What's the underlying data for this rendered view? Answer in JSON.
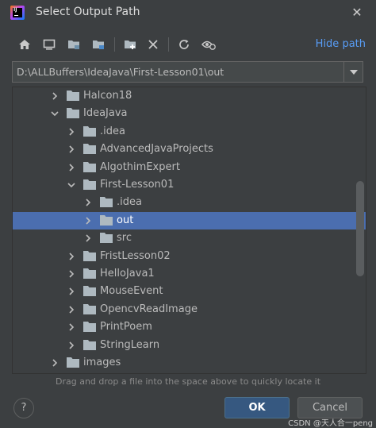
{
  "window": {
    "title": "Select Output Path"
  },
  "toolbar": {
    "icons": [
      "home-icon",
      "desktop-icon",
      "project-folder-icon",
      "module-folder-icon",
      "new-folder-icon",
      "delete-icon",
      "refresh-icon",
      "show-hidden-icon"
    ],
    "hide_path_label": "Hide path"
  },
  "path": {
    "value": "D:\\ALLBuffers\\IdeaJava\\First-Lesson01\\out"
  },
  "tree": {
    "rows": [
      {
        "label": "Halcon18",
        "depth": 0,
        "expanded": false,
        "selected": false
      },
      {
        "label": "IdeaJava",
        "depth": 0,
        "expanded": true,
        "selected": false
      },
      {
        "label": ".idea",
        "depth": 1,
        "expanded": false,
        "selected": false
      },
      {
        "label": "AdvancedJavaProjects",
        "depth": 1,
        "expanded": false,
        "selected": false
      },
      {
        "label": "AlgothimExpert",
        "depth": 1,
        "expanded": false,
        "selected": false
      },
      {
        "label": "First-Lesson01",
        "depth": 1,
        "expanded": true,
        "selected": false
      },
      {
        "label": ".idea",
        "depth": 2,
        "expanded": false,
        "selected": false
      },
      {
        "label": "out",
        "depth": 2,
        "expanded": false,
        "selected": true
      },
      {
        "label": "src",
        "depth": 2,
        "expanded": false,
        "selected": false
      },
      {
        "label": "FristLesson02",
        "depth": 1,
        "expanded": false,
        "selected": false
      },
      {
        "label": "HelloJava1",
        "depth": 1,
        "expanded": false,
        "selected": false
      },
      {
        "label": "MouseEvent",
        "depth": 1,
        "expanded": false,
        "selected": false
      },
      {
        "label": "OpencvReadImage",
        "depth": 1,
        "expanded": false,
        "selected": false
      },
      {
        "label": "PrintPoem",
        "depth": 1,
        "expanded": false,
        "selected": false
      },
      {
        "label": "StringLearn",
        "depth": 1,
        "expanded": false,
        "selected": false
      },
      {
        "label": "images",
        "depth": 0,
        "expanded": false,
        "selected": false
      }
    ]
  },
  "hint": "Drag and drop a file into the space above to quickly locate it",
  "footer": {
    "help_label": "?",
    "ok_label": "OK",
    "cancel_label": "Cancel"
  },
  "watermark": "CSDN @天人合一peng",
  "colors": {
    "background": "#3c3f41",
    "selection": "#4b6eaf",
    "link": "#589df6",
    "ok_button": "#365880",
    "folder": "#aeb9c0"
  }
}
